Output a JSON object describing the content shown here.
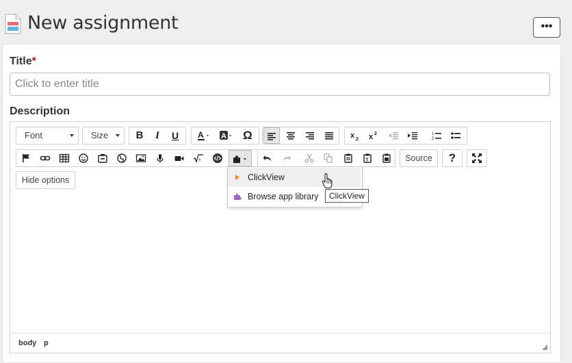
{
  "header": {
    "title": "New assignment",
    "more_label": "•••"
  },
  "form": {
    "title_label": "Title",
    "required_mark": "*",
    "title_placeholder": "Click to enter title",
    "description_label": "Description"
  },
  "toolbar": {
    "font_label": "Font",
    "size_label": "Size",
    "bold": "B",
    "italic": "I",
    "underline": "U",
    "special_char": "Ω",
    "source_label": "Source",
    "help": "?",
    "hide_options_label": "Hide options"
  },
  "plugin_menu": {
    "items": [
      {
        "label": "ClickView",
        "icon": "play-icon"
      },
      {
        "label": "Browse app library",
        "icon": "puzzle-icon"
      }
    ],
    "tooltip": "ClickView"
  },
  "statusbar": {
    "path": [
      "body",
      "p"
    ]
  },
  "colors": {
    "page_bg": "#efefef",
    "required": "#a02020",
    "clickview_icon": "#e8892b",
    "puzzle_icon": "#9b6cc0"
  }
}
